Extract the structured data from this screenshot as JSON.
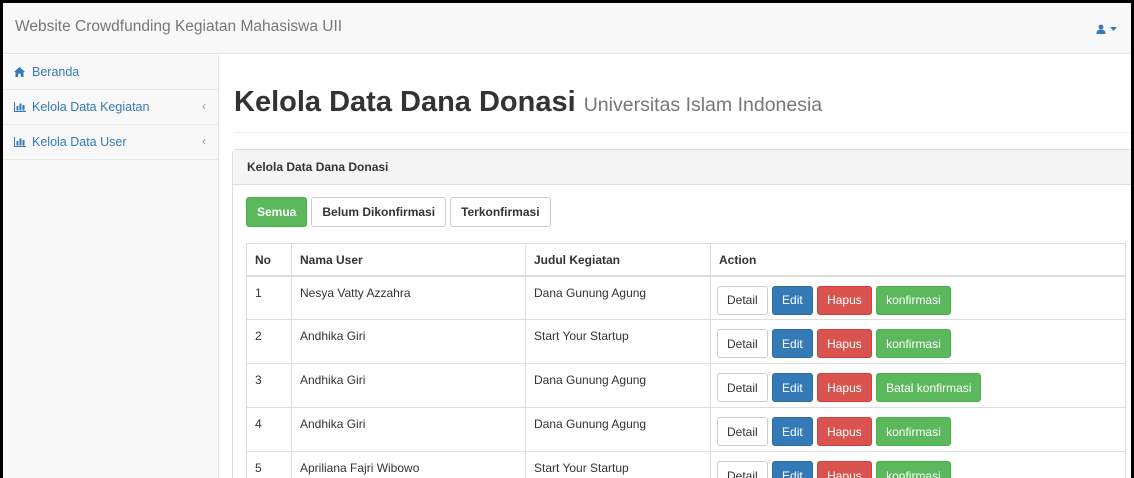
{
  "navbar": {
    "brand": "Website Crowdfunding Kegiatan Mahasiswa UII"
  },
  "sidebar": {
    "items": [
      {
        "label": "Beranda",
        "icon": "home-icon"
      },
      {
        "label": "Kelola Data Kegiatan",
        "icon": "bar-chart-icon",
        "chevron": "‹"
      },
      {
        "label": "Kelola Data User",
        "icon": "bar-chart-icon",
        "chevron": "‹"
      }
    ]
  },
  "page": {
    "title": "Kelola Data Dana Donasi",
    "subtitle": "Universitas Islam Indonesia"
  },
  "panel": {
    "heading": "Kelola Data Dana Donasi",
    "tabs": [
      "Semua",
      "Belum Dikonfirmasi",
      "Terkonfirmasi"
    ]
  },
  "table": {
    "headers": [
      "No",
      "Nama User",
      "Judul Kegiatan",
      "Action"
    ],
    "rows": [
      {
        "no": "1",
        "user": "Nesya Vatty Azzahra",
        "judul": "Dana Gunung Agung",
        "confirm": "konfirmasi"
      },
      {
        "no": "2",
        "user": "Andhika Giri",
        "judul": "Start Your Startup",
        "confirm": "konfirmasi"
      },
      {
        "no": "3",
        "user": "Andhika Giri",
        "judul": "Dana Gunung Agung",
        "confirm": "Batal konfirmasi"
      },
      {
        "no": "4",
        "user": "Andhika Giri",
        "judul": "Dana Gunung Agung",
        "confirm": "konfirmasi"
      },
      {
        "no": "5",
        "user": "Apriliana Fajri Wibowo",
        "judul": "Start Your Startup",
        "confirm": "konfirmasi"
      }
    ],
    "actions": {
      "detail": "Detail",
      "edit": "Edit",
      "hapus": "Hapus"
    }
  },
  "colors": {
    "link": "#337ab7",
    "success": "#5cb85c",
    "primary": "#337ab7",
    "danger": "#d9534f"
  }
}
